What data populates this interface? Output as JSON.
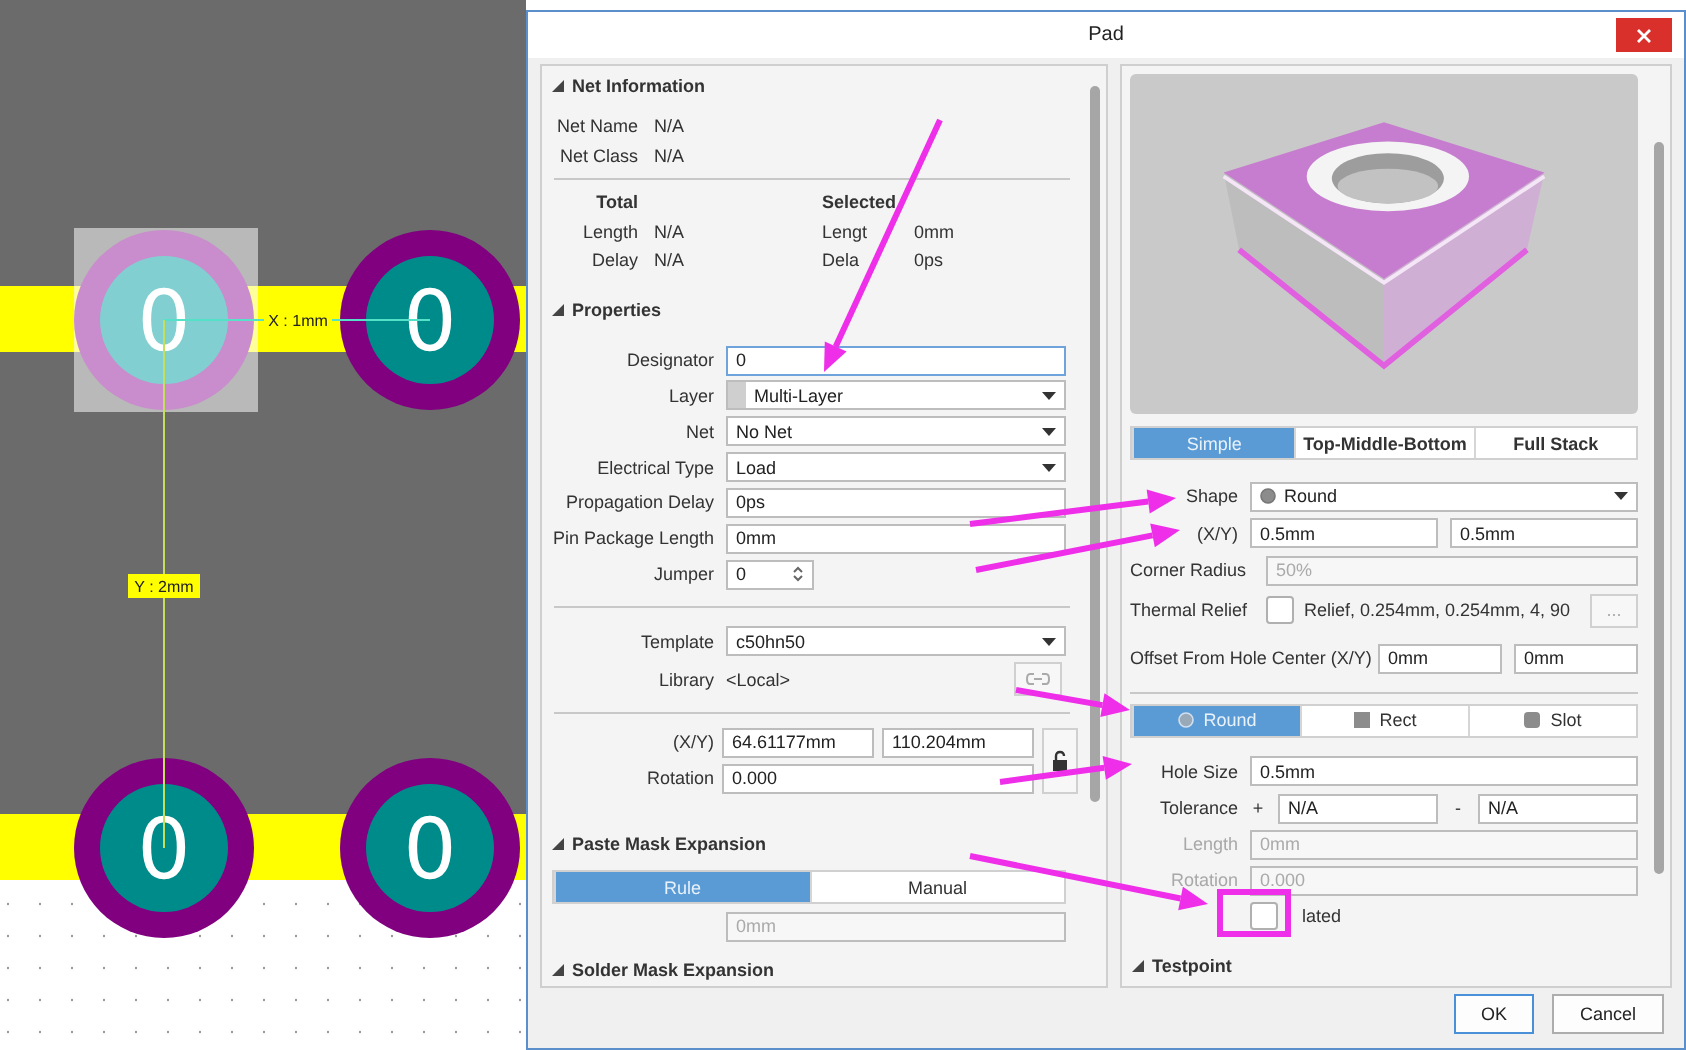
{
  "canvas": {
    "pads": [
      {
        "label": "0",
        "selected": true
      },
      {
        "label": "0",
        "selected": false
      },
      {
        "label": "0",
        "selected": false
      },
      {
        "label": "0",
        "selected": false
      }
    ],
    "x_dimension": {
      "label": "X : 1mm"
    },
    "y_dimension": {
      "label": "Y : 2mm"
    }
  },
  "dialog": {
    "title": "Pad",
    "buttons": [
      {
        "label": "OK",
        "default": true
      },
      {
        "label": "Cancel",
        "default": false
      }
    ]
  },
  "net_information": {
    "title": "Net Information",
    "expanded": true,
    "fields": [
      {
        "label": "Net Name",
        "value": "N/A"
      },
      {
        "label": "Net Class",
        "value": "N/A"
      }
    ],
    "headings": [
      "Total",
      "Selected"
    ],
    "totals": [
      {
        "total_label": "Length",
        "total_value": "N/A",
        "selected_label": "Lengt",
        "selected_value": "0mm"
      },
      {
        "total_label": "Delay",
        "total_value": "N/A",
        "selected_label": "Dela",
        "selected_value": "0ps"
      }
    ]
  },
  "properties": {
    "title": "Properties",
    "expanded": true,
    "rows": [
      {
        "kind": "text",
        "label": "Designator",
        "value": "0",
        "focused": true
      },
      {
        "kind": "layer",
        "label": "Layer",
        "value": "Multi-Layer"
      },
      {
        "kind": "select",
        "label": "Net",
        "value": "No Net"
      },
      {
        "kind": "select",
        "label": "Electrical Type",
        "value": "Load"
      },
      {
        "kind": "text",
        "label": "Propagation Delay",
        "value": "0ps",
        "focused": false
      },
      {
        "kind": "text",
        "label": "Pin Package Length",
        "value": "0mm",
        "focused": false
      },
      {
        "kind": "spin",
        "label": "Jumper",
        "value": "0"
      }
    ],
    "template": {
      "label": "Template",
      "value": "c50hn50"
    },
    "library": {
      "label": "Library",
      "value": "<Local>"
    },
    "location": {
      "xy_label": "(X/Y)",
      "x": "64.61177mm",
      "y": "110.204mm",
      "rotation_label": "Rotation",
      "rotation": "0.000"
    }
  },
  "paste_mask": {
    "title": "Paste Mask Expansion",
    "expanded": true,
    "modes": [
      {
        "label": "Rule",
        "selected": true
      },
      {
        "label": "Manual",
        "selected": false
      }
    ],
    "value": "0mm",
    "disabled": true
  },
  "solder_mask": {
    "title": "Solder Mask Expansion",
    "expanded": true
  },
  "view_tabs": [
    {
      "label": "Simple",
      "selected": true
    },
    {
      "label": "Top-Middle-Bottom",
      "selected": false
    },
    {
      "label": "Full Stack",
      "selected": false
    }
  ],
  "pad_shape": {
    "shape_label": "Shape",
    "shape": "Round",
    "xy_label": "(X/Y)",
    "x": "0.5mm",
    "y": "0.5mm",
    "corner": {
      "label": "Corner Radius",
      "value": "50%",
      "disabled": true
    },
    "thermal": {
      "label": "Thermal Relief",
      "checked": false,
      "value": "Relief, 0.254mm, 0.254mm, 4, 90",
      "button": "..."
    },
    "offset": {
      "label": "Offset From Hole Center (X/Y)",
      "x": "0mm",
      "y": "0mm"
    }
  },
  "hole": {
    "shapes": [
      {
        "label": "Round",
        "kind": "round",
        "selected": true
      },
      {
        "label": "Rect",
        "kind": "rect",
        "selected": false
      },
      {
        "label": "Slot",
        "kind": "slot",
        "selected": false
      }
    ],
    "size_label": "Hole Size",
    "size": "0.5mm",
    "tolerance": {
      "label": "Tolerance",
      "plus_sign": "+",
      "plus": "N/A",
      "minus_sign": "-",
      "minus": "N/A"
    },
    "length": {
      "label": "Length",
      "value": "0mm",
      "disabled": true
    },
    "rotation": {
      "label": "Rotation",
      "value": "0.000",
      "disabled": true
    },
    "plated": {
      "label": "lated",
      "checked": false
    }
  },
  "testpoint": {
    "title": "Testpoint",
    "expanded": true
  }
}
